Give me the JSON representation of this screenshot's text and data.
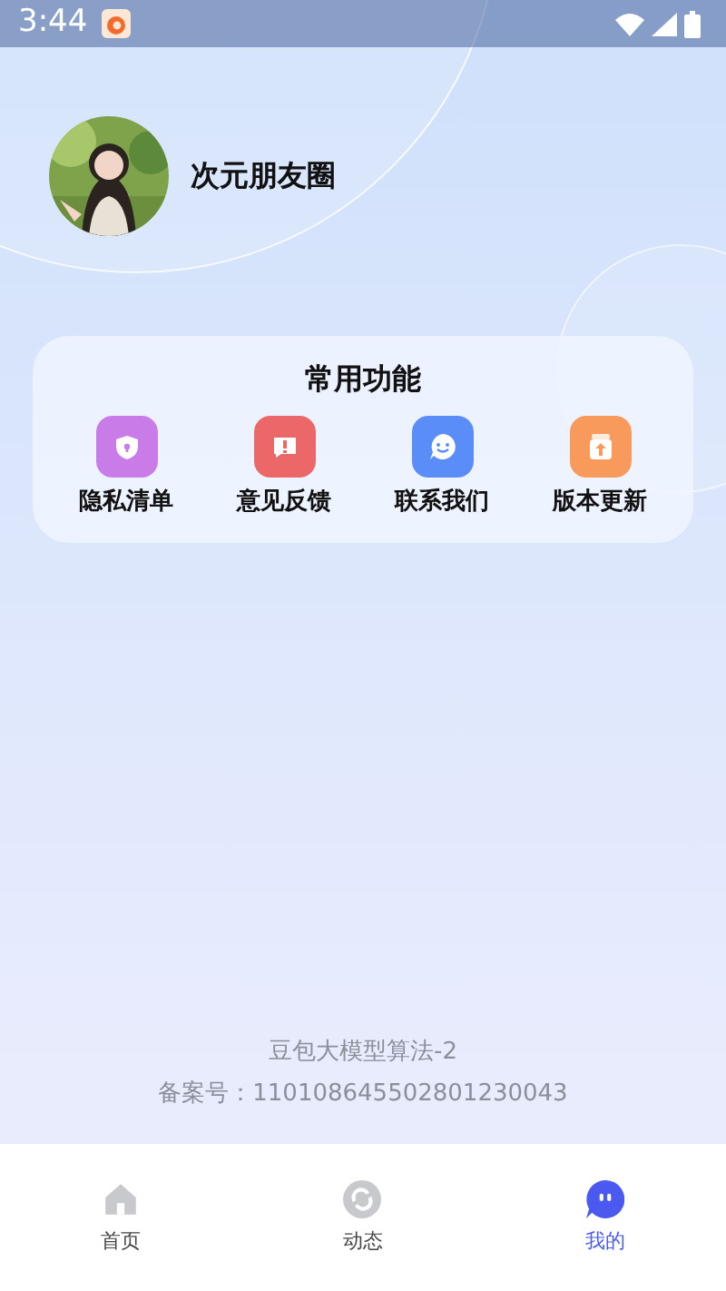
{
  "status_bar": {
    "time": "3:44"
  },
  "profile": {
    "name": "次元朋友圈"
  },
  "functions": {
    "title": "常用功能",
    "items": [
      {
        "label": "隐私清单",
        "kind": "shield",
        "color": "#c97ce8"
      },
      {
        "label": "意见反馈",
        "kind": "alert",
        "color": "#ec6767"
      },
      {
        "label": "联系我们",
        "kind": "chat",
        "color": "#5a8df8"
      },
      {
        "label": "版本更新",
        "kind": "upgrade",
        "color": "#f99a5d"
      }
    ]
  },
  "footer": {
    "lines": [
      "豆包大模型算法-2",
      "备案号：110108645502801230043"
    ]
  },
  "tab_bar": [
    {
      "label": "首页",
      "kind": "home",
      "selected": false
    },
    {
      "label": "动态",
      "kind": "dynamic",
      "selected": false
    },
    {
      "label": "我的",
      "kind": "mine",
      "selected": true
    }
  ]
}
